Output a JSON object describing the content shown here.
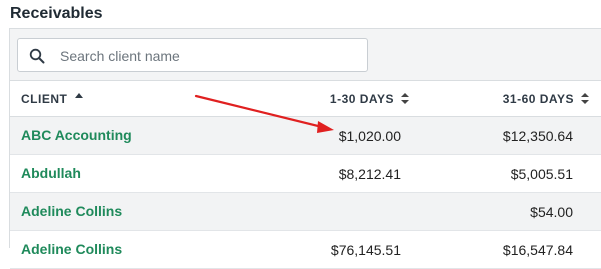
{
  "page": {
    "title": "Receivables"
  },
  "search": {
    "placeholder": "Search client name"
  },
  "table": {
    "headers": {
      "client": "CLIENT",
      "days_1_30": "1-30 DAYS",
      "days_31_60": "31-60 DAYS"
    },
    "rows": [
      {
        "client": "ABC Accounting",
        "days_1_30": "$1,020.00",
        "days_31_60": "$12,350.64"
      },
      {
        "client": "Abdullah",
        "days_1_30": "$8,212.41",
        "days_31_60": "$5,005.51"
      },
      {
        "client": "Adeline Collins",
        "days_1_30": "",
        "days_31_60": "$54.00"
      },
      {
        "client": "Adeline Collins",
        "days_1_30": "$76,145.51",
        "days_31_60": "$16,547.84"
      }
    ]
  },
  "annotation": {
    "arrow_color": "#e02020"
  },
  "colors": {
    "client_link": "#1f8a5b",
    "border": "#d9dde0"
  }
}
